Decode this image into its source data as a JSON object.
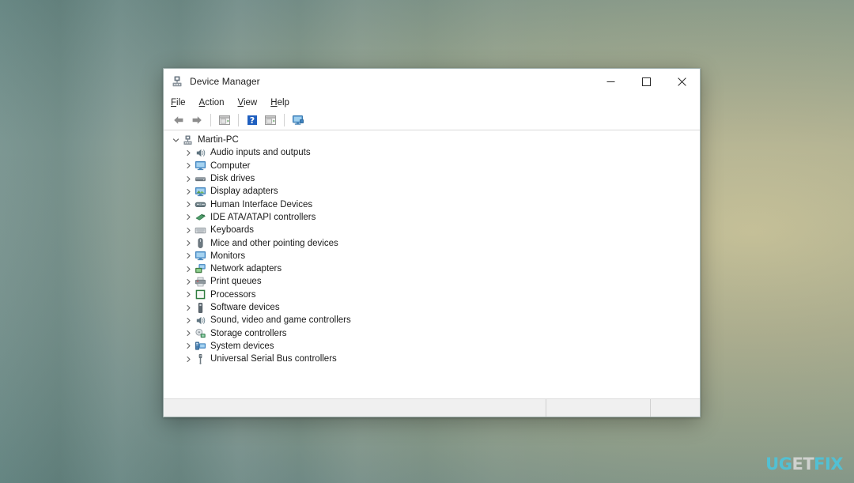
{
  "desktop": {
    "watermark": {
      "part1": "UG",
      "part2": "ET",
      "part3": "FIX",
      "cyan": "#49c7e0",
      "gray": "#dcdcdc"
    },
    "background_colors": {
      "left": "#3c6260",
      "right": "#c2bb9a"
    }
  },
  "window": {
    "title": "Device Manager",
    "title_icon": "device-manager-icon",
    "caption": {
      "minimize": "minimize-icon",
      "maximize": "maximize-icon",
      "close": "close-icon"
    },
    "menubar": [
      {
        "label": "File",
        "accesskey": "F",
        "rest": "ile"
      },
      {
        "label": "Action",
        "accesskey": "A",
        "rest": "ction"
      },
      {
        "label": "View",
        "accesskey": "V",
        "rest": "iew"
      },
      {
        "label": "Help",
        "accesskey": "H",
        "rest": "elp"
      }
    ],
    "toolbar": [
      {
        "name": "back-arrow-icon",
        "title": "Back"
      },
      {
        "name": "forward-arrow-icon",
        "title": "Forward"
      },
      {
        "name": "separator",
        "title": ""
      },
      {
        "name": "properties-icon",
        "title": "Properties"
      },
      {
        "name": "separator",
        "title": ""
      },
      {
        "name": "help-icon",
        "title": "Help"
      },
      {
        "name": "update-driver-icon",
        "title": "Update driver"
      },
      {
        "name": "separator",
        "title": ""
      },
      {
        "name": "scan-hardware-icon",
        "title": "Scan for hardware changes"
      }
    ],
    "tree": {
      "root": {
        "label": "Martin-PC",
        "icon": "computer-node-icon",
        "expanded": true
      },
      "children": [
        {
          "label": "Audio inputs and outputs",
          "icon": "speaker-icon"
        },
        {
          "label": "Computer",
          "icon": "monitor-icon"
        },
        {
          "label": "Disk drives",
          "icon": "disk-drive-icon"
        },
        {
          "label": "Display adapters",
          "icon": "display-adapter-icon"
        },
        {
          "label": "Human Interface Devices",
          "icon": "hid-icon"
        },
        {
          "label": "IDE ATA/ATAPI controllers",
          "icon": "ide-controller-icon"
        },
        {
          "label": "Keyboards",
          "icon": "keyboard-icon"
        },
        {
          "label": "Mice and other pointing devices",
          "icon": "mouse-icon"
        },
        {
          "label": "Monitors",
          "icon": "monitor-icon"
        },
        {
          "label": "Network adapters",
          "icon": "network-adapter-icon"
        },
        {
          "label": "Print queues",
          "icon": "printer-icon"
        },
        {
          "label": "Processors",
          "icon": "processor-icon"
        },
        {
          "label": "Software devices",
          "icon": "software-device-icon"
        },
        {
          "label": "Sound, video and game controllers",
          "icon": "speaker-icon"
        },
        {
          "label": "Storage controllers",
          "icon": "storage-controller-icon"
        },
        {
          "label": "System devices",
          "icon": "system-device-icon"
        },
        {
          "label": "Universal Serial Bus controllers",
          "icon": "usb-icon"
        }
      ]
    },
    "statusbar": {
      "pane1": "",
      "pane2": "",
      "pane3": ""
    }
  }
}
